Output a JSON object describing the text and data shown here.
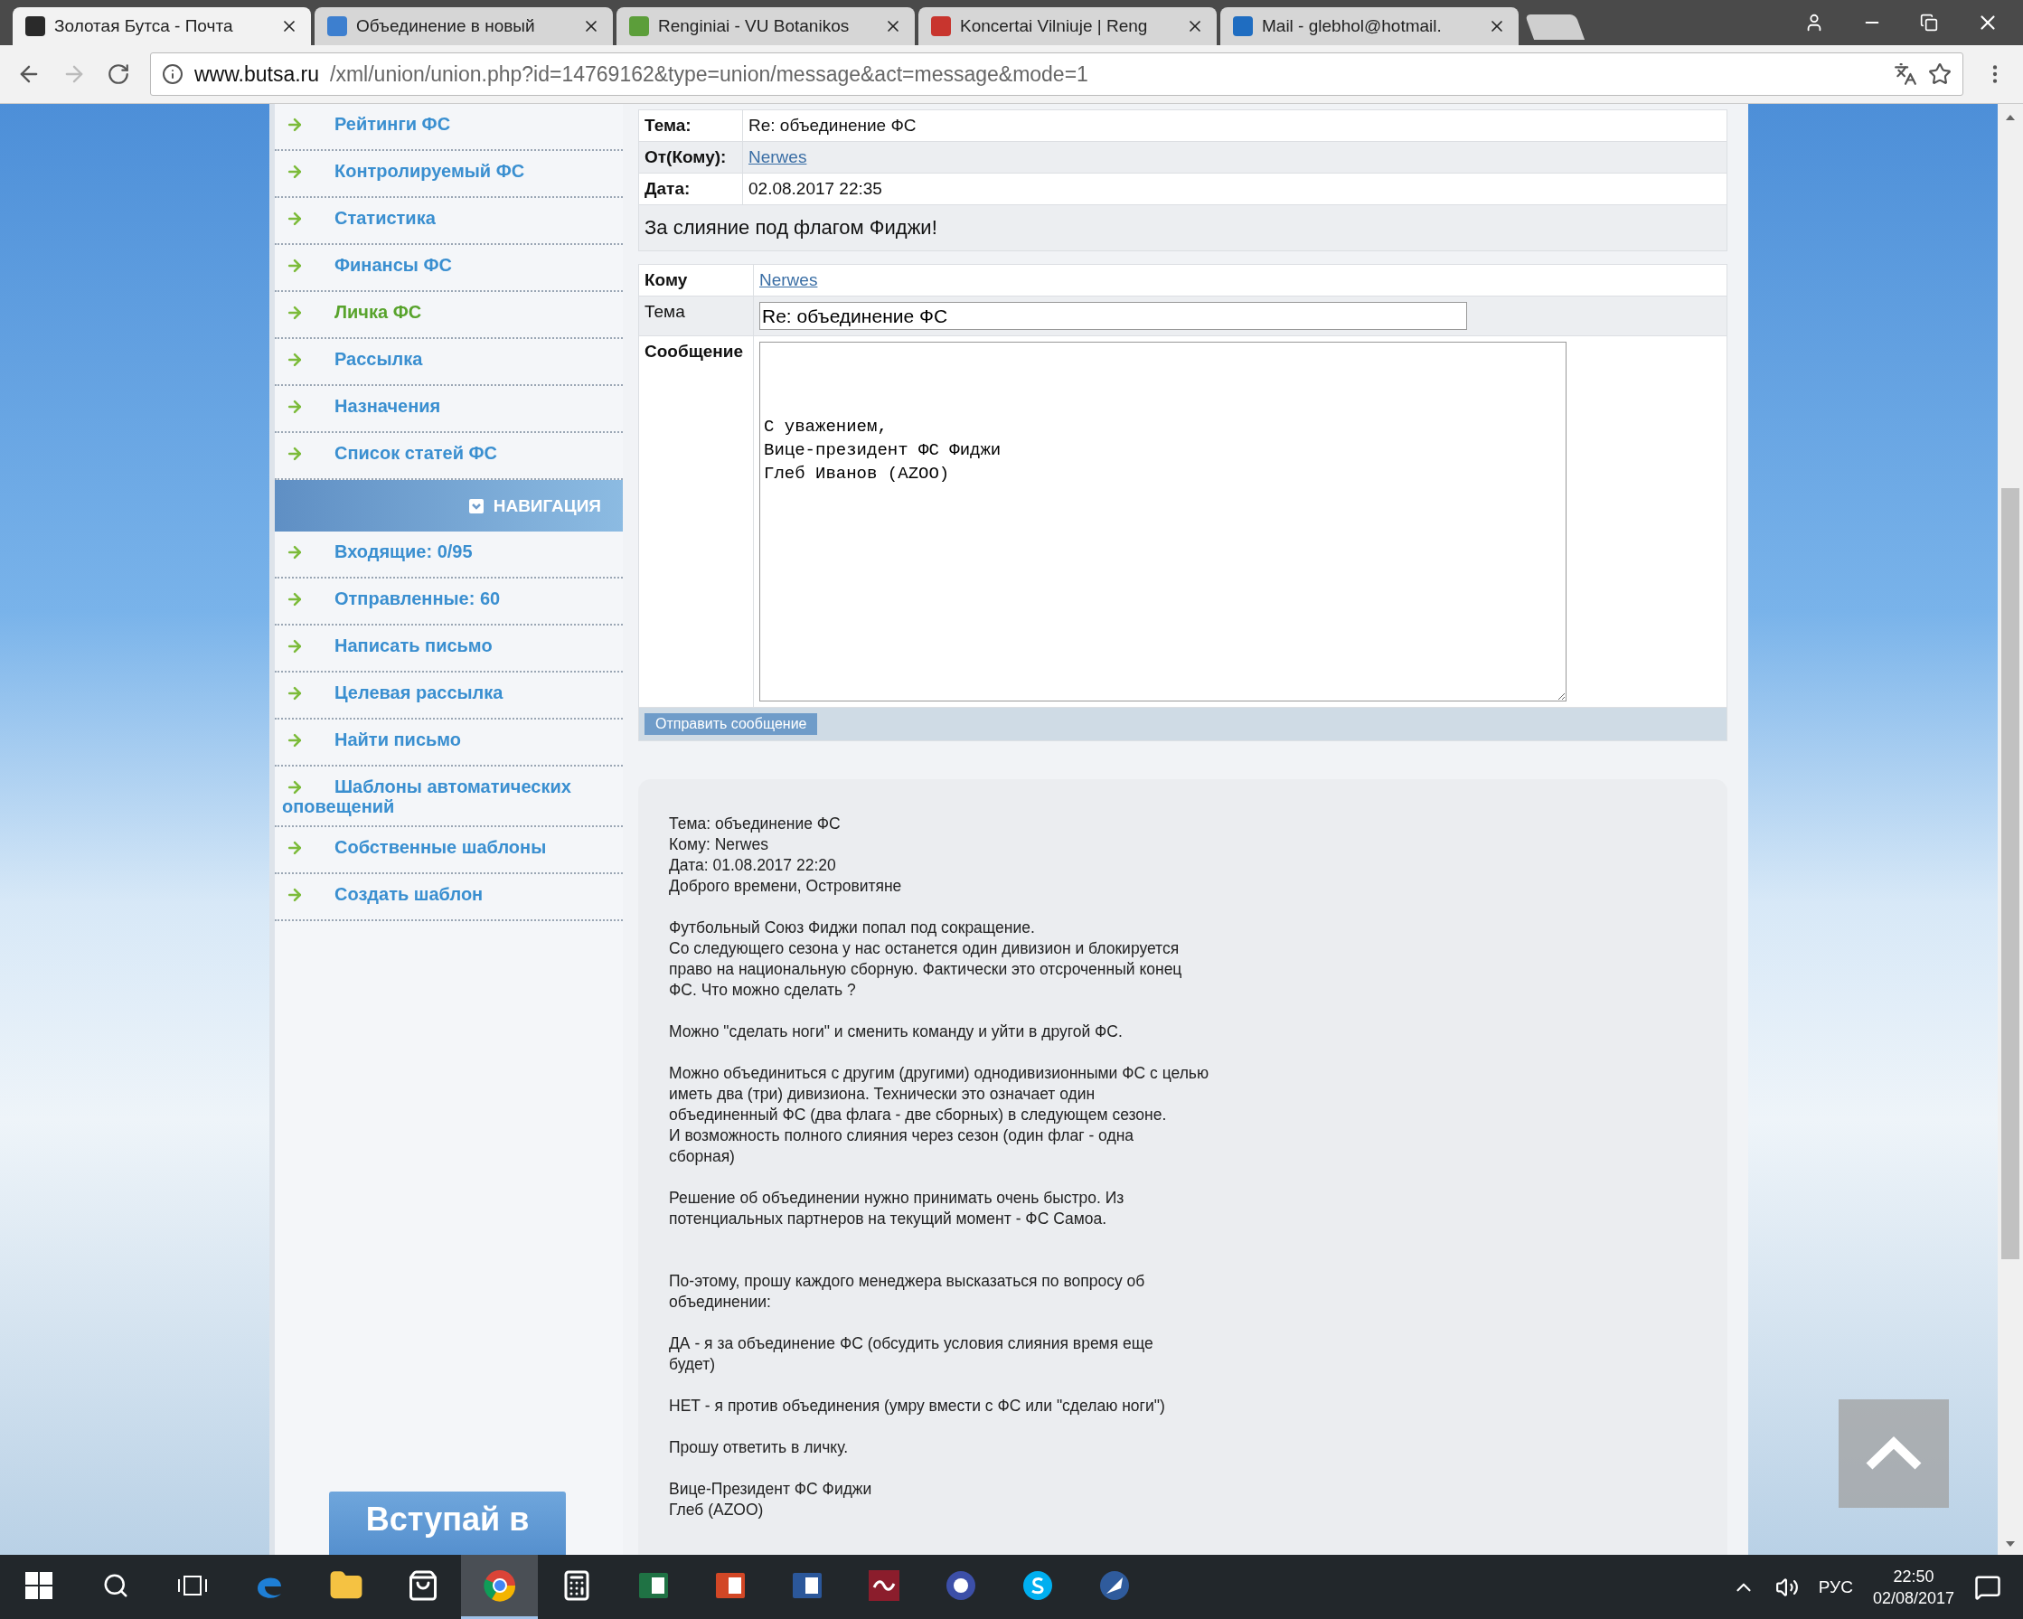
{
  "browser": {
    "tabs": [
      {
        "title": "Золотая Бутса - Почта",
        "selected": true
      },
      {
        "title": "Объединение в новый",
        "selected": false
      },
      {
        "title": "Renginiai - VU Botanikos",
        "selected": false
      },
      {
        "title": "Koncertai Vilniuje | Reng",
        "selected": false
      },
      {
        "title": "Mail - glebhol@hotmail.",
        "selected": false
      }
    ],
    "url_host": "www.butsa.ru",
    "url_path": "/xml/union/union.php?id=14769162&type=union/message&act=message&mode=1"
  },
  "sidebar": {
    "items_top": [
      {
        "label": "Рейтинги ФС",
        "selected": false
      },
      {
        "label": "Контролируемый ФС",
        "selected": false
      },
      {
        "label": "Статистика",
        "selected": false
      },
      {
        "label": "Финансы ФС",
        "selected": false
      },
      {
        "label": "Личка ФС",
        "selected": true
      },
      {
        "label": "Рассылка",
        "selected": false
      },
      {
        "label": "Назначения",
        "selected": false
      },
      {
        "label": "Список статей ФС",
        "selected": false
      }
    ],
    "nav_header": "НАВИГАЦИЯ",
    "items_bottom": [
      {
        "label": "Входящие: 0/95",
        "selected": false
      },
      {
        "label": "Отправленные: 60",
        "selected": false
      },
      {
        "label": "Написать письмо",
        "selected": false
      },
      {
        "label": "Целевая рассылка",
        "selected": false
      },
      {
        "label": "Найти письмо",
        "selected": false
      },
      {
        "label": "Шаблоны автоматических оповещений",
        "selected": false
      },
      {
        "label": "Собственные шаблоны",
        "selected": false
      },
      {
        "label": "Создать шаблон",
        "selected": false
      }
    ],
    "banner": "Вступай в"
  },
  "message": {
    "fields": [
      {
        "label": "Тема:",
        "value": "Re: объединение ФС",
        "kind": "text"
      },
      {
        "label": "От(Кому):",
        "value": "Nerwes",
        "kind": "link"
      },
      {
        "label": "Дата:",
        "value": "02.08.2017 22:35",
        "kind": "text"
      }
    ],
    "body": "За слияние под флагом Фиджи!"
  },
  "reply": {
    "to_label": "Кому",
    "to_value": "Nerwes",
    "subject_label": "Тема",
    "subject_value": "Re: объединение ФС",
    "message_label": "Сообщение",
    "message_value": "\n\n\nС уважением,\nВице-президент ФС Фиджи\nГлеб Иванов (AZOO)",
    "send_button": "Отправить сообщение"
  },
  "quote": {
    "text": "Тема: объединение ФС\nКому: Nerwes\nДата: 01.08.2017 22:20\nДоброго времени, Островитяне\n\nФутбольный Союз Фиджи попал под сокращение.\nСо следующего сезона у нас останется один дивизион и блокируется\nправо на национальную сборную. Фактически это отсроченный конец\nФС. Что можно сделать ?\n\nМожно \"сделать ноги\" и сменить команду и уйти в другой ФС.\n\nМожно объединиться с другим (другими) однодивизионными ФС с целью\nиметь два (три) дивизиона. Технически это означает один\nобъединенный ФС (два флага - две сборных) в следующем сезоне.\nИ возможность полного слияния через сезон (один флаг - одна\nсборная)\n\nРешение об объединении нужно принимать очень быстро. Из\nпотенциальных партнеров на текущий момент - ФС Самоа.\n\n\nПо-этому, прошу каждого менеджера высказаться по вопросу об\nобъединении:\n\nДА - я за объединение ФС (обсудить условия слияния время еще\nбудет)\n\nНЕТ - я против объединения (умру вмести с ФС или \"сделаю ноги\")\n\nПрошу ответить в личку.\n\nВице-Президент ФС Фиджи\nГлеб (AZOO)"
  },
  "taskbar": {
    "apps": [
      {
        "kind": "edge",
        "running": false,
        "selected": false
      },
      {
        "kind": "folder",
        "running": false,
        "selected": false
      },
      {
        "kind": "store",
        "running": false,
        "selected": false
      },
      {
        "kind": "chrome",
        "running": true,
        "selected": true
      },
      {
        "kind": "calculator",
        "running": false,
        "selected": false
      },
      {
        "kind": "excel",
        "running": false,
        "selected": false
      },
      {
        "kind": "slides",
        "running": false,
        "selected": false
      },
      {
        "kind": "word",
        "running": false,
        "selected": false
      },
      {
        "kind": "wave",
        "running": false,
        "selected": false
      },
      {
        "kind": "globe",
        "running": false,
        "selected": false
      },
      {
        "kind": "skype",
        "running": false,
        "selected": false
      },
      {
        "kind": "feather",
        "running": false,
        "selected": false
      }
    ],
    "language": "РУС",
    "time": "22:50",
    "date": "02/08/2017"
  }
}
